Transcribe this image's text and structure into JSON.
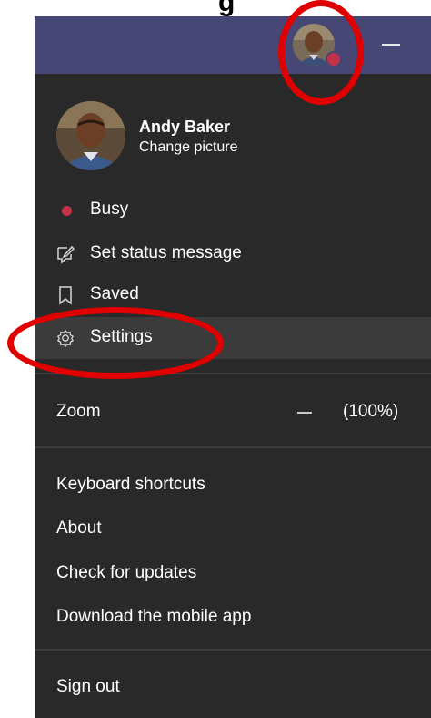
{
  "caption": {
    "text": "g"
  },
  "profile": {
    "name": "Andy Baker",
    "change_picture": "Change picture"
  },
  "menu": {
    "busy": "Busy",
    "set_status": "Set status message",
    "saved": "Saved",
    "settings": "Settings",
    "zoom_label": "Zoom",
    "zoom_minus": "–",
    "zoom_value": "(100%)",
    "keyboard_shortcuts": "Keyboard shortcuts",
    "about": "About",
    "check_updates": "Check for updates",
    "download_app": "Download the mobile app",
    "sign_out": "Sign out"
  },
  "colors": {
    "titlebar": "#464775",
    "menu_bg": "#292929",
    "busy_status": "#c4314b",
    "highlight_ring": "#e00000"
  }
}
